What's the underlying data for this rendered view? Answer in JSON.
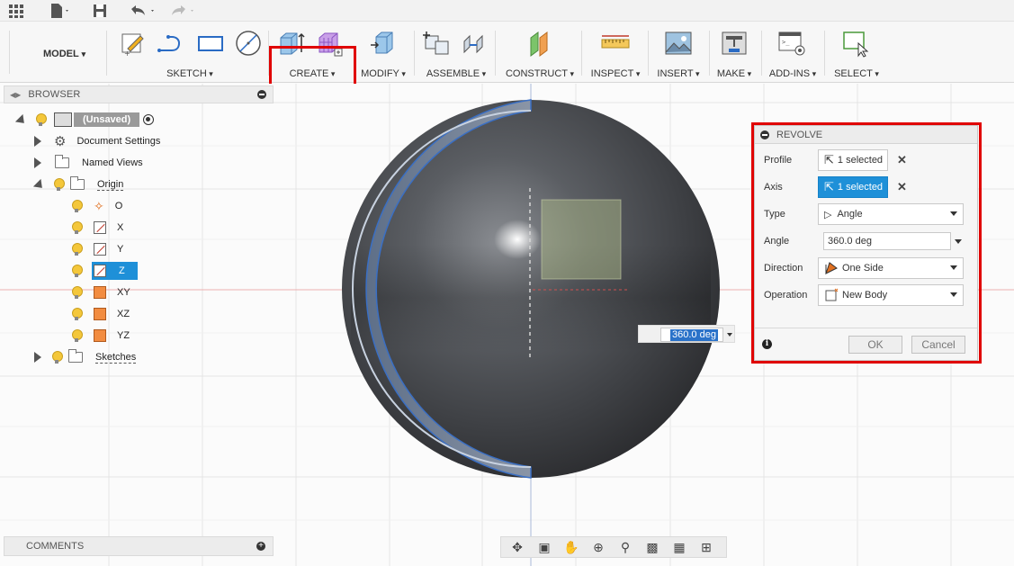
{
  "ribbon": {
    "workspace": "MODEL",
    "groups": {
      "sketch": "SKETCH",
      "create": "CREATE",
      "modify": "MODIFY",
      "assemble": "ASSEMBLE",
      "construct": "CONSTRUCT",
      "inspect": "INSPECT",
      "insert": "INSERT",
      "make": "MAKE",
      "addins": "ADD-INS",
      "select": "SELECT"
    }
  },
  "browser": {
    "title": "BROWSER",
    "root": "(Unsaved)",
    "items": {
      "document_settings": "Document Settings",
      "named_views": "Named Views",
      "origin": "Origin",
      "o": "O",
      "x": "X",
      "y": "Y",
      "z": "Z",
      "xy": "XY",
      "xz": "XZ",
      "yz": "YZ",
      "sketches": "Sketches"
    }
  },
  "comments": {
    "title": "COMMENTS"
  },
  "revolve": {
    "title": "REVOLVE",
    "profile": {
      "label": "Profile",
      "value": "1 selected"
    },
    "axis": {
      "label": "Axis",
      "value": "1 selected"
    },
    "type": {
      "label": "Type",
      "value": "Angle"
    },
    "angle": {
      "label": "Angle",
      "value": "360.0 deg"
    },
    "direction": {
      "label": "Direction",
      "value": "One Side"
    },
    "operation": {
      "label": "Operation",
      "value": "New Body"
    },
    "ok": "OK",
    "cancel": "Cancel"
  },
  "canvas": {
    "angle_input": "360.0 deg"
  },
  "colors": {
    "highlight": "#e00000",
    "accent": "#1e90d8",
    "body_edge": "#3a6fc4",
    "grid_axis_red": "#e88080"
  }
}
